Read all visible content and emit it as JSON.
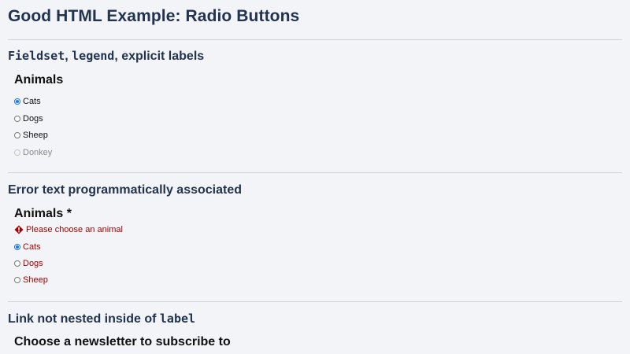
{
  "page": {
    "title": "Good HTML Example: Radio Buttons"
  },
  "section1": {
    "heading_code1": "Fieldset",
    "heading_sep": ", ",
    "heading_code2": "legend",
    "heading_rest": ", explicit labels",
    "legend": "Animals",
    "options": [
      {
        "label": "Cats",
        "checked": true,
        "disabled": false
      },
      {
        "label": "Dogs",
        "checked": false,
        "disabled": false
      },
      {
        "label": "Sheep",
        "checked": false,
        "disabled": false
      },
      {
        "label": "Donkey",
        "checked": false,
        "disabled": true
      }
    ]
  },
  "section2": {
    "heading": "Error text programmatically associated",
    "legend": "Animals *",
    "error_text": "Please choose an animal",
    "error_icon": "error-icon",
    "options": [
      {
        "label": "Cats",
        "checked": true
      },
      {
        "label": "Dogs",
        "checked": false
      },
      {
        "label": "Sheep",
        "checked": false
      }
    ]
  },
  "section3": {
    "heading_text": "Link not nested inside of ",
    "heading_code": "label",
    "legend": "Choose a newsletter to subscribe to"
  },
  "colors": {
    "heading": "#22334f",
    "error": "#a80000",
    "radio_checked": "#1a73e8",
    "background": "#f3f4f8"
  }
}
